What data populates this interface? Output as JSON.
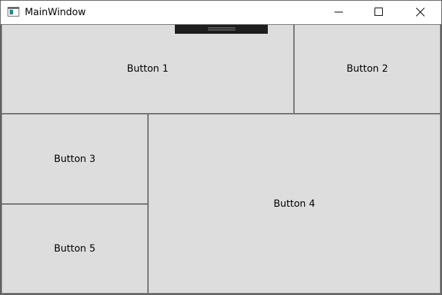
{
  "window": {
    "title": "MainWindow"
  },
  "titlebar": {
    "icons": {
      "app": "application-icon",
      "minimize": "minimize-icon",
      "maximize": "maximize-icon",
      "close": "close-icon"
    }
  },
  "buttons": {
    "button1": "Button 1",
    "button2": "Button 2",
    "button3": "Button 3",
    "button4": "Button 4",
    "button5": "Button 5"
  },
  "colors": {
    "button_background": "#dddddd",
    "button_border": "#707070",
    "debug_strip": "#1e1e1e"
  }
}
